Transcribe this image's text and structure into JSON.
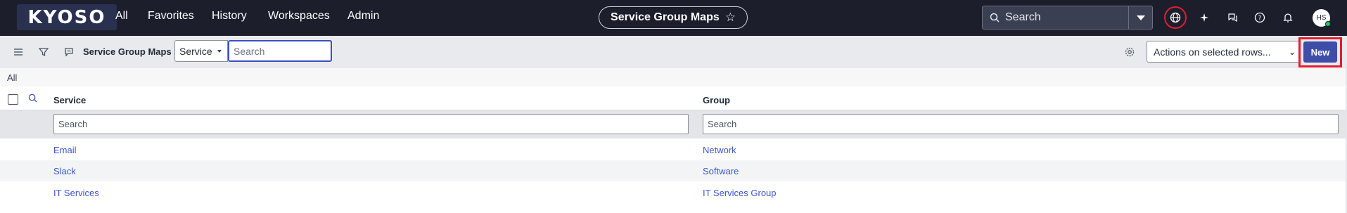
{
  "brand": {
    "logo_text": "KYOSO"
  },
  "nav": {
    "items": [
      {
        "label": "All"
      },
      {
        "label": "Favorites"
      },
      {
        "label": "History"
      },
      {
        "label": "Workspaces"
      },
      {
        "label": "Admin"
      }
    ],
    "page_title": "Service Group Maps",
    "global_search_placeholder": "Search",
    "user_initials": "HS",
    "icons": [
      "globe-icon",
      "sparkle-icon",
      "chat-icon",
      "help-icon",
      "bell-icon"
    ]
  },
  "toolbar": {
    "list_title": "Service Group Maps",
    "field_selected": "Service",
    "search_placeholder": "Search",
    "actions_label": "Actions on selected rows...",
    "new_label": "New"
  },
  "breadcrumb": "All",
  "table": {
    "columns": [
      {
        "label": "Service",
        "filter_placeholder": "Search"
      },
      {
        "label": "Group",
        "filter_placeholder": "Search"
      }
    ],
    "rows": [
      {
        "service": "Email",
        "group": "Network"
      },
      {
        "service": "Slack",
        "group": "Software"
      },
      {
        "service": "IT Services",
        "group": "IT Services Group"
      }
    ]
  },
  "colors": {
    "nav_bg": "#1c1e2c",
    "accent": "#3e4ea8",
    "link": "#3b56c8",
    "highlight": "#e11d2e"
  }
}
